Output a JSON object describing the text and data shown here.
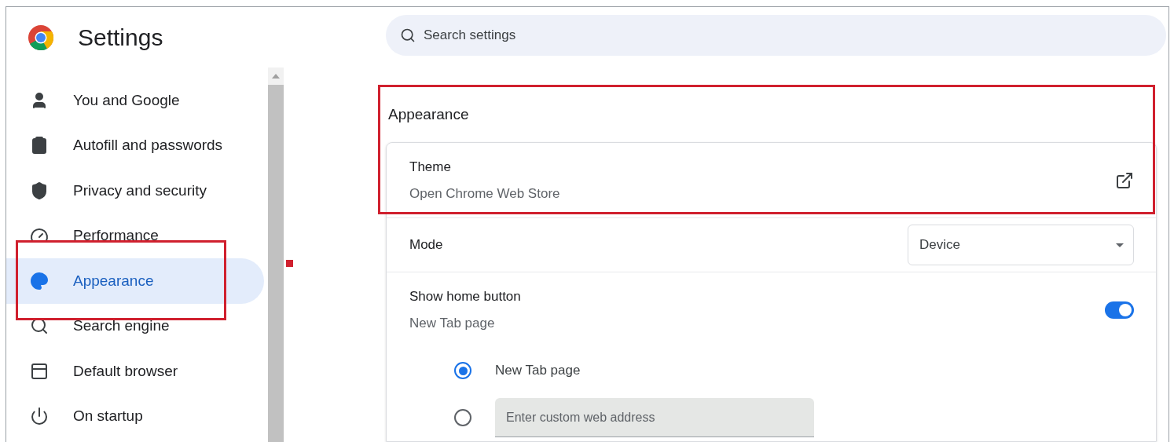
{
  "header": {
    "title": "Settings"
  },
  "search": {
    "placeholder": "Search settings"
  },
  "sidebar": {
    "items": [
      {
        "label": "You and Google",
        "selected": false
      },
      {
        "label": "Autofill and passwords",
        "selected": false
      },
      {
        "label": "Privacy and security",
        "selected": false
      },
      {
        "label": "Performance",
        "selected": false
      },
      {
        "label": "Appearance",
        "selected": true
      },
      {
        "label": "Search engine",
        "selected": false
      },
      {
        "label": "Default browser",
        "selected": false
      },
      {
        "label": "On startup",
        "selected": false
      }
    ]
  },
  "section": {
    "title": "Appearance",
    "theme": {
      "label": "Theme",
      "sublabel": "Open Chrome Web Store"
    },
    "mode": {
      "label": "Mode",
      "value": "Device"
    },
    "home_button": {
      "label": "Show home button",
      "sublabel": "New Tab page",
      "on": true
    },
    "options": [
      {
        "kind": "text",
        "label": "New Tab page",
        "selected": true
      },
      {
        "kind": "input",
        "placeholder": "Enter custom web address",
        "selected": false
      }
    ]
  }
}
